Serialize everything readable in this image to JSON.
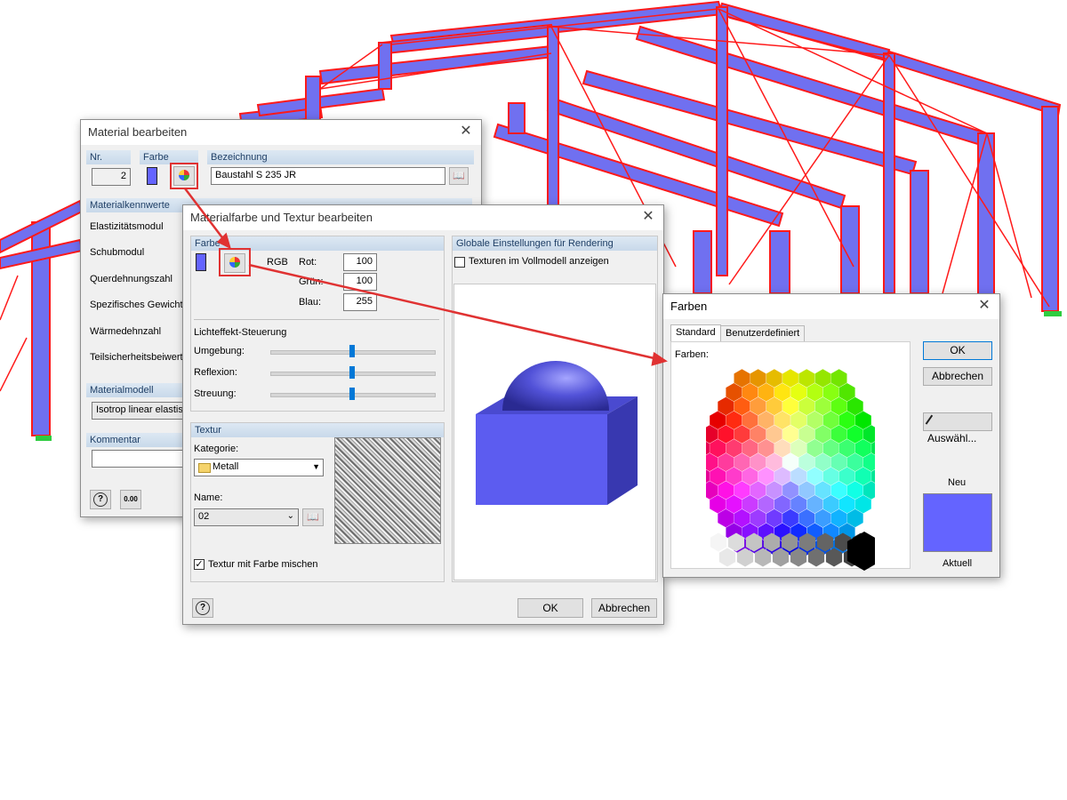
{
  "dialog1": {
    "title": "Material bearbeiten",
    "nr_label": "Nr.",
    "nr_value": "2",
    "farbe_label": "Farbe",
    "bezeichnung_label": "Bezeichnung",
    "bezeichnung_value": "Baustahl S 235 JR",
    "kennwerte_title": "Materialkennwerte",
    "kennwerte": [
      "Elastizitätsmodul",
      "Schubmodul",
      "Querdehnungszahl",
      "Spezifisches Gewicht",
      "Wärmedehnzahl",
      "Teilsicherheitsbeiwert"
    ],
    "materialmodell_title": "Materialmodell",
    "materialmodell_value": "Isotrop linear elastisch",
    "kommentar_title": "Kommentar",
    "units_icon_text": "0.00"
  },
  "dialog2": {
    "title": "Materialfarbe und Textur bearbeiten",
    "farbe_title": "Farbe",
    "rgb_label": "RGB",
    "rot_label": "Rot:",
    "rot_value": "100",
    "gruen_label": "Grün:",
    "gruen_value": "100",
    "blau_label": "Blau:",
    "blau_value": "255",
    "licht_title": "Lichteffekt-Steuerung",
    "umgebung_label": "Umgebung:",
    "reflexion_label": "Reflexion:",
    "streuung_label": "Streuung:",
    "textur_title": "Textur",
    "kategorie_label": "Kategorie:",
    "kategorie_value": "Metall",
    "name_label": "Name:",
    "name_value": "02",
    "mischen_label": "Textur mit Farbe mischen",
    "global_title": "Globale Einstellungen für Rendering",
    "vollmodell_label": "Texturen im Vollmodell anzeigen",
    "ok_label": "OK",
    "cancel_label": "Abbrechen"
  },
  "dialog3": {
    "title": "Farben",
    "tab_standard": "Standard",
    "tab_custom": "Benutzerdefiniert",
    "farben_label": "Farben:",
    "ok_label": "OK",
    "cancel_label": "Abbrechen",
    "pick_label": "Auswähl...",
    "neu_label": "Neu",
    "aktuell_label": "Aktuell",
    "new_color": "#6464ff"
  },
  "colors": {
    "material": "#6464ff",
    "beam_edge": "#ff1a1a",
    "highlight": "#e03232"
  }
}
